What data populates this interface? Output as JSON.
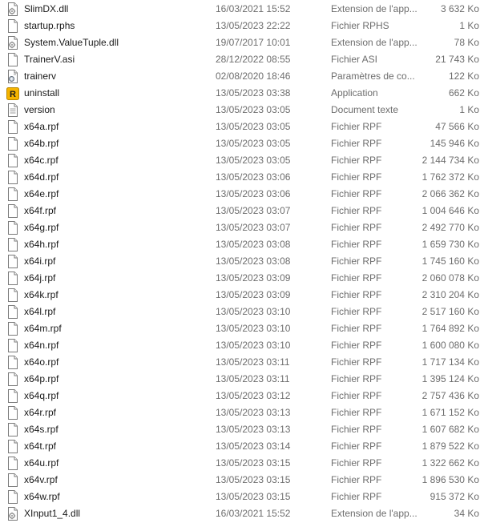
{
  "files": [
    {
      "name": "SlimDX.dll",
      "date": "16/03/2021 15:52",
      "type": "Extension de l'app...",
      "size": "3 632 Ko",
      "icon": "dll-file-icon"
    },
    {
      "name": "startup.rphs",
      "date": "13/05/2023 22:22",
      "type": "Fichier RPHS",
      "size": "1 Ko",
      "icon": "blank-file-icon"
    },
    {
      "name": "System.ValueTuple.dll",
      "date": "19/07/2017 10:01",
      "type": "Extension de l'app...",
      "size": "78 Ko",
      "icon": "dll-file-icon"
    },
    {
      "name": "TrainerV.asi",
      "date": "28/12/2022 08:55",
      "type": "Fichier ASI",
      "size": "21 743 Ko",
      "icon": "blank-file-icon"
    },
    {
      "name": "trainerv",
      "date": "02/08/2020 18:46",
      "type": "Paramètres de co...",
      "size": "122 Ko",
      "icon": "config-file-icon"
    },
    {
      "name": "uninstall",
      "date": "13/05/2023 03:38",
      "type": "Application",
      "size": "662 Ko",
      "icon": "rockstar-app-icon"
    },
    {
      "name": "version",
      "date": "13/05/2023 03:05",
      "type": "Document texte",
      "size": "1 Ko",
      "icon": "text-file-icon"
    },
    {
      "name": "x64a.rpf",
      "date": "13/05/2023 03:05",
      "type": "Fichier RPF",
      "size": "47 566 Ko",
      "icon": "blank-file-icon"
    },
    {
      "name": "x64b.rpf",
      "date": "13/05/2023 03:05",
      "type": "Fichier RPF",
      "size": "145 946 Ko",
      "icon": "blank-file-icon"
    },
    {
      "name": "x64c.rpf",
      "date": "13/05/2023 03:05",
      "type": "Fichier RPF",
      "size": "2 144 734 Ko",
      "icon": "blank-file-icon"
    },
    {
      "name": "x64d.rpf",
      "date": "13/05/2023 03:06",
      "type": "Fichier RPF",
      "size": "1 762 372 Ko",
      "icon": "blank-file-icon"
    },
    {
      "name": "x64e.rpf",
      "date": "13/05/2023 03:06",
      "type": "Fichier RPF",
      "size": "2 066 362 Ko",
      "icon": "blank-file-icon"
    },
    {
      "name": "x64f.rpf",
      "date": "13/05/2023 03:07",
      "type": "Fichier RPF",
      "size": "1 004 646 Ko",
      "icon": "blank-file-icon"
    },
    {
      "name": "x64g.rpf",
      "date": "13/05/2023 03:07",
      "type": "Fichier RPF",
      "size": "2 492 770 Ko",
      "icon": "blank-file-icon"
    },
    {
      "name": "x64h.rpf",
      "date": "13/05/2023 03:08",
      "type": "Fichier RPF",
      "size": "1 659 730 Ko",
      "icon": "blank-file-icon"
    },
    {
      "name": "x64i.rpf",
      "date": "13/05/2023 03:08",
      "type": "Fichier RPF",
      "size": "1 745 160 Ko",
      "icon": "blank-file-icon"
    },
    {
      "name": "x64j.rpf",
      "date": "13/05/2023 03:09",
      "type": "Fichier RPF",
      "size": "2 060 078 Ko",
      "icon": "blank-file-icon"
    },
    {
      "name": "x64k.rpf",
      "date": "13/05/2023 03:09",
      "type": "Fichier RPF",
      "size": "2 310 204 Ko",
      "icon": "blank-file-icon"
    },
    {
      "name": "x64l.rpf",
      "date": "13/05/2023 03:10",
      "type": "Fichier RPF",
      "size": "2 517 160 Ko",
      "icon": "blank-file-icon"
    },
    {
      "name": "x64m.rpf",
      "date": "13/05/2023 03:10",
      "type": "Fichier RPF",
      "size": "1 764 892 Ko",
      "icon": "blank-file-icon"
    },
    {
      "name": "x64n.rpf",
      "date": "13/05/2023 03:10",
      "type": "Fichier RPF",
      "size": "1 600 080 Ko",
      "icon": "blank-file-icon"
    },
    {
      "name": "x64o.rpf",
      "date": "13/05/2023 03:11",
      "type": "Fichier RPF",
      "size": "1 717 134 Ko",
      "icon": "blank-file-icon"
    },
    {
      "name": "x64p.rpf",
      "date": "13/05/2023 03:11",
      "type": "Fichier RPF",
      "size": "1 395 124 Ko",
      "icon": "blank-file-icon"
    },
    {
      "name": "x64q.rpf",
      "date": "13/05/2023 03:12",
      "type": "Fichier RPF",
      "size": "2 757 436 Ko",
      "icon": "blank-file-icon"
    },
    {
      "name": "x64r.rpf",
      "date": "13/05/2023 03:13",
      "type": "Fichier RPF",
      "size": "1 671 152 Ko",
      "icon": "blank-file-icon"
    },
    {
      "name": "x64s.rpf",
      "date": "13/05/2023 03:13",
      "type": "Fichier RPF",
      "size": "1 607 682 Ko",
      "icon": "blank-file-icon"
    },
    {
      "name": "x64t.rpf",
      "date": "13/05/2023 03:14",
      "type": "Fichier RPF",
      "size": "1 879 522 Ko",
      "icon": "blank-file-icon"
    },
    {
      "name": "x64u.rpf",
      "date": "13/05/2023 03:15",
      "type": "Fichier RPF",
      "size": "1 322 662 Ko",
      "icon": "blank-file-icon"
    },
    {
      "name": "x64v.rpf",
      "date": "13/05/2023 03:15",
      "type": "Fichier RPF",
      "size": "1 896 530 Ko",
      "icon": "blank-file-icon"
    },
    {
      "name": "x64w.rpf",
      "date": "13/05/2023 03:15",
      "type": "Fichier RPF",
      "size": "915 372 Ko",
      "icon": "blank-file-icon"
    },
    {
      "name": "XInput1_4.dll",
      "date": "16/03/2021 15:52",
      "type": "Extension de l'app...",
      "size": "34 Ko",
      "icon": "dll-file-icon"
    }
  ],
  "colors": {
    "text_primary": "#1a1a1a",
    "text_secondary": "#6d6d6d",
    "hover": "#e5f3ff",
    "rockstar_yellow": "#f5b400"
  }
}
